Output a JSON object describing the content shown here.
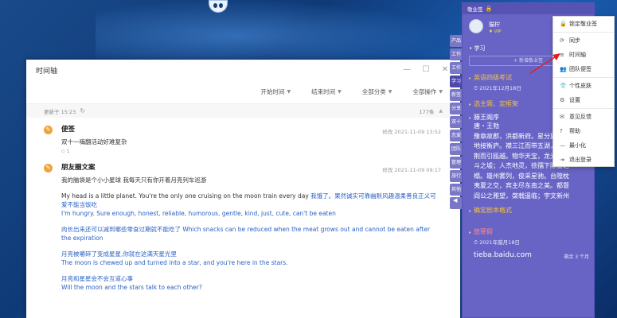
{
  "timeline": {
    "title": "时间轴",
    "filters": [
      {
        "label": "开始时间"
      },
      {
        "label": "结束时间"
      },
      {
        "label": "全部分类"
      },
      {
        "label": "全部操作"
      }
    ],
    "updated": "更新于 15:23",
    "count": "177条",
    "notes": [
      {
        "title": "便签",
        "time": "修改 2021-11-09 13:52",
        "body": "双十一嗨翻活动好难复杂",
        "meta": "1"
      },
      {
        "title": "朋友圈文案",
        "time": "修改 2021-11-09 09:17",
        "lines": [
          {
            "text": "我的脑袋是个小小星球 我每天只有你开着月亮列车巡游",
            "style": "dark"
          },
          {
            "text": "My head is a little planet. You're the only one cruising on the moon train every day",
            "style": "dark"
          },
          {
            "text": "我饿了。果然诚实可靠幽默风趣温柔善良正义可爱不能当饭吃",
            "style": "blue"
          },
          {
            "text": "I'm hungry. Sure enough, honest, reliable, humorous, gentle, kind, just, cute, can't be eaten",
            "style": "blue"
          },
          {
            "text": "肉长出来还可以减到哪些零食过期就不能吃了 Which snacks can be reduced when the meat grows out and cannot be eaten after the expiration",
            "style": "blue"
          },
          {
            "text": "月亮被嚼碎了变成星星,你就在这满天星光里",
            "style": "blue"
          },
          {
            "text": "The moon is chewed up and turned into a star, and you're here in the stars.",
            "style": "blue"
          },
          {
            "text": "月亮和星星会不会互道心事",
            "style": "blue"
          },
          {
            "text": "Will the moon and the stars talk to each other?",
            "style": "blue"
          }
        ]
      }
    ]
  },
  "sticky": {
    "app_name": "敬业签",
    "username": "猫柠",
    "vip": "VIP",
    "category": "学习",
    "new_note": "+ 新增敬业签",
    "side_tabs": [
      "产品",
      "工作",
      "工作",
      "学习",
      "新签",
      "分享",
      "双十",
      "恋爱",
      "团队",
      "管理",
      "旅行",
      "其他"
    ],
    "entries": [
      {
        "title": "英语四级考试",
        "date": "2021年12月18日"
      },
      {
        "title": "选主题、定框架"
      }
    ],
    "poem": {
      "title": "滕王阁序",
      "lines": [
        "唐・王勃",
        "豫章故郡，洪都新府。星分翼轸，",
        "地接衡庐。襟三江而带五湖，控蛮",
        "荆而引瓯越。物华天宝，龙光射牛",
        "斗之墟；人杰地灵，徐孺下陈蕃之",
        "榻。雄州雾列，俊采星驰。台隍枕",
        "夷夏之交，宾主尽东南之美。都督",
        "阎公之雅望，棨戟遥临；宇文新州"
      ]
    },
    "footer": "剩余 3 个月",
    "entries2": [
      {
        "title": "确定剧本格式"
      },
      {
        "title": "放寒假",
        "date": "2021年腊月18日"
      }
    ],
    "watermark": "tieba.baidu.com"
  },
  "menu": {
    "items": [
      {
        "icon": "🔒",
        "label": "锁定敬业签"
      },
      {
        "icon": "⟳",
        "label": "同步"
      },
      {
        "icon": "≡",
        "label": "时间轴"
      },
      {
        "icon": "👥",
        "label": "团队便签"
      },
      {
        "icon": "👕",
        "label": "个性皮肤"
      },
      {
        "icon": "⚙",
        "label": "设置"
      },
      {
        "icon": "✉",
        "label": "意见反馈"
      },
      {
        "icon": "?",
        "label": "帮助"
      },
      {
        "icon": "—",
        "label": "最小化"
      },
      {
        "icon": "⇥",
        "label": "退出登录"
      }
    ]
  },
  "colors": {
    "panel": "#6864c6",
    "accent": "#f5c040",
    "link_blue": "#2a62c4",
    "arrow": "#e02020"
  }
}
